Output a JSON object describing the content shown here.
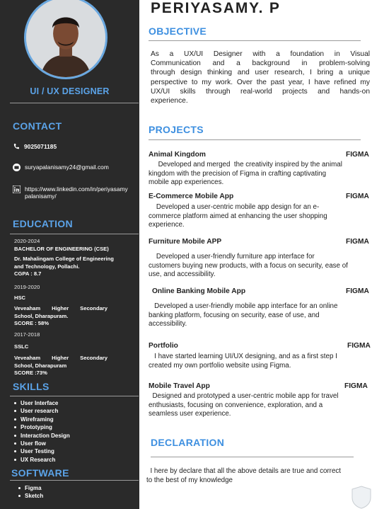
{
  "name": "PERIYASAMY. P",
  "role": "UI / UX DESIGNER",
  "contact": {
    "title": "CONTACT",
    "phone": "9025071185",
    "email": "suryapalanisamy24@gmail.com",
    "linkedin_line1": "https://www.linkedin.com/in/periyasamy",
    "linkedin_line2": "palanisamy/"
  },
  "education": {
    "title": "EDUCATION",
    "entries": [
      {
        "year": "2020-2024",
        "degree": "BACHELOR OF ENGINEERING (CSE)",
        "inst1": "Dr. Mahalingam College of Engineering",
        "inst2": "and Technology, Pollachi.",
        "score": "CGPA : 8.7"
      },
      {
        "year": "2019-2020",
        "degree": "HSC",
        "inst1": "Veveaham Higher Secondary",
        "inst2": "School, Dharapuram.",
        "score": "SCORE : 58%"
      },
      {
        "year": "2017-2018",
        "degree": "SSLC",
        "inst1": "Veveaham Higher Secondary",
        "inst2": "School, Dharapuram",
        "score": "SCORE :73%"
      }
    ]
  },
  "skills": {
    "title": "SKILLS",
    "items": [
      "User Interface",
      "User research",
      "Wireframing",
      "Prototyping",
      "Interaction Design",
      "User flow",
      "User Testing",
      "UX Research"
    ]
  },
  "software": {
    "title": "SOFTWARE",
    "items": [
      "Figma",
      "Sketch"
    ]
  },
  "objective": {
    "title": "OBJECTIVE",
    "lines": [
      "As a UX/UI Designer with a foundation in Visual",
      "Communication and a background in problem-solving",
      "through design thinking and user research, I bring a unique",
      "perspective to my work. Over the past year, I have refined my",
      "UX/UI skills through real-world projects and hands-on",
      "experience."
    ]
  },
  "projects": {
    "title": "PROJECTS",
    "items": [
      {
        "name": "Animal Kingdom",
        "tag": "FIGMA",
        "lines": [
          "     Developed and merged  the creativity inspired by the animal",
          "kingdom with the precision of Figma in crafting captivating",
          "mobile app experiences."
        ]
      },
      {
        "name": "E-Commerce Mobile App",
        "tag": "FIGMA",
        "lines": [
          "    Developed a user-centric mobile app design for an e-",
          "commerce platform aimed at enhancing the user shopping",
          "experience."
        ]
      },
      {
        "name": "Furniture Mobile APP",
        "tag": "FIGMA",
        "lines": [
          "    Developed a user-friendly furniture app interface for",
          "customers buying new products, with a focus on security, ease of",
          "use, and accessibility."
        ]
      },
      {
        "name": "Online Banking Mobile App",
        "tag": "FIGMA",
        "lines": [
          "   Developed a user-friendly mobile app interface for an online",
          "banking platform, focusing on security, ease of use, and",
          "accessibility."
        ]
      },
      {
        "name": "Portfolio",
        "tag": "FIGMA",
        "lines": [
          "   I have started learning UI/UX designing, and as a first step I",
          "created my own portfolio website using Figma."
        ]
      },
      {
        "name": "Mobile Travel App",
        "tag": "FIGMA",
        "lines": [
          "  Designed and prototyped a user-centric mobile app for travel",
          "enthusiasts, focusing on convenience, exploration, and a",
          "seamless user experience."
        ]
      }
    ]
  },
  "declaration": {
    "title": "DECLARATION",
    "line1": "  I here by declare that all the above details are true and correct",
    "line2": "to the best of my knowledge"
  }
}
